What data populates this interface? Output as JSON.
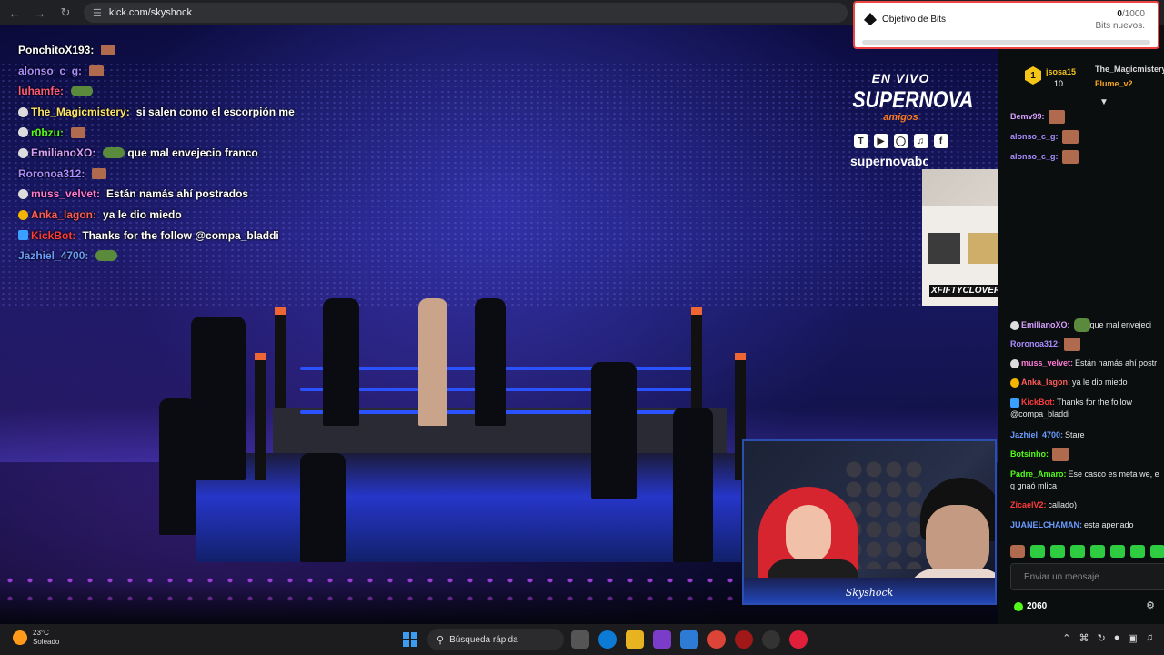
{
  "browser": {
    "url": "kick.com/skyshock",
    "back_icon": "arrow-left-icon",
    "forward_icon": "arrow-right-icon",
    "reload_icon": "reload-icon"
  },
  "bits_goal": {
    "title": "Objetivo de Bits",
    "current": "0",
    "total": "/1000",
    "subtitle": "Bits nuevos.",
    "progress": 0.0
  },
  "overlay_chat": [
    {
      "user": "PonchitoX193:",
      "text": "",
      "color": "#ffffff",
      "badge": "",
      "emote": "brown"
    },
    {
      "user": "alonso_c_g:",
      "text": "",
      "color": "#a98cff",
      "badge": "",
      "emote": "brown"
    },
    {
      "user": "luhamfe:",
      "text": "",
      "color": "#ff5b7b",
      "badge": "",
      "emote": "frog"
    },
    {
      "user": "The_Magicmistery:",
      "text": "si salen como el escorpión me",
      "color": "#ffe66b",
      "badge": "white",
      "emote": ""
    },
    {
      "user": "r0bzu:",
      "text": "",
      "color": "#53fc18",
      "badge": "white",
      "emote": "brown"
    },
    {
      "user": "EmilianoXO:",
      "text": "que mal envejecio franco",
      "color": "#d8a0ff",
      "badge": "white",
      "emote": "frog"
    },
    {
      "user": "Roronoa312:",
      "text": "",
      "color": "#a98cff",
      "badge": "",
      "emote": "brown"
    },
    {
      "user": "muss_velvet:",
      "text": "Están namás ahí postrados",
      "color": "#ff7ad9",
      "badge": "white",
      "emote": ""
    },
    {
      "user": "Anka_lagon:",
      "text": "ya le dio miedo",
      "color": "#ff5b5b",
      "badge": "gold",
      "emote": ""
    },
    {
      "user": "KickBot:",
      "text": "Thanks for the follow @compa_bladdi",
      "color": "#ff3b3b",
      "badge": "blue",
      "emote": ""
    },
    {
      "user": "Jazhiel_4700:",
      "text": "",
      "color": "#6a9cff",
      "badge": "",
      "emote": "frog"
    }
  ],
  "event": {
    "live_label": "EN VIVO",
    "title": "SUPERNOVA",
    "subtitle": "amigos",
    "handle": "supernovabox",
    "social_icons": [
      "twitch-icon",
      "youtube-icon",
      "instagram-icon",
      "tiktok-icon",
      "facebook-icon"
    ]
  },
  "webcams": {
    "top_name": "XFIFTYCLOVERX",
    "bottom_signature": "Skyshock"
  },
  "kick_chat": {
    "leaderboard": [
      {
        "rank": "1",
        "name": "jsosa15",
        "count": "10"
      },
      {
        "name": "The_Magicmistery"
      },
      {
        "name": "Flume_v2"
      }
    ],
    "messages_top": [
      {
        "user": "Bemv99:",
        "text": "",
        "color": "#d8a0ff",
        "badge": "",
        "emote": "brown"
      },
      {
        "user": "alonso_c_g:",
        "text": "",
        "color": "#a98cff",
        "badge": "",
        "emote": "brown"
      },
      {
        "user": "alonso_c_g:",
        "text": "",
        "color": "#a98cff",
        "badge": "",
        "emote": "brown"
      }
    ],
    "messages": [
      {
        "user": "EmilianoXO:",
        "text": "que mal envejeci",
        "color": "#d8a0ff",
        "badge": "white",
        "emote": "frog"
      },
      {
        "user": "Roronoa312:",
        "text": "",
        "color": "#a98cff",
        "badge": "",
        "emote": "brown"
      },
      {
        "user": "muss_velvet:",
        "text": "Están namás ahí postr",
        "color": "#ff7ad9",
        "badge": "white",
        "emote": ""
      },
      {
        "user": "Anka_lagon:",
        "text": "ya le dio miedo",
        "color": "#ff5b5b",
        "badge": "gold",
        "emote": ""
      },
      {
        "user": "KickBot:",
        "text": "Thanks for the follow @compa_bladdi",
        "color": "#ff3b3b",
        "badge": "blue",
        "emote": ""
      },
      {
        "user": "Jazhiel_4700:",
        "text": "Stare",
        "color": "#6a9cff",
        "badge": "",
        "emote": ""
      },
      {
        "user": "Botsinho:",
        "text": "",
        "color": "#53fc18",
        "badge": "",
        "emote": "brown"
      },
      {
        "user": "Padre_Amaro:",
        "text": "Ese casco es meta we, e q gnaó mlica",
        "color": "#53fc18",
        "badge": "",
        "emote": ""
      },
      {
        "user": "ZicaelV2:",
        "text": "callado)",
        "color": "#ff3b3b",
        "badge": "",
        "emote": ""
      },
      {
        "user": "JUANELCHAMAN:",
        "text": "esta apenado",
        "color": "#6a9cff",
        "badge": "",
        "emote": ""
      }
    ],
    "input_placeholder": "Enviar un mensaje",
    "points": "2060",
    "settings_icon": "gear-icon"
  },
  "taskbar": {
    "temperature": "23°C",
    "weather": "Soleado",
    "search_label": "Búsqueda rápida",
    "apps": [
      "file-icon",
      "edge-icon",
      "folder-icon",
      "purple-app-icon",
      "blue-app-icon",
      "chrome-icon",
      "red-app-icon",
      "obs-icon",
      "opera-icon"
    ],
    "tray_icons": [
      "chevron-up-icon",
      "wifi-icon",
      "sync-icon",
      "mic-icon",
      "display-icon",
      "volume-icon"
    ]
  }
}
